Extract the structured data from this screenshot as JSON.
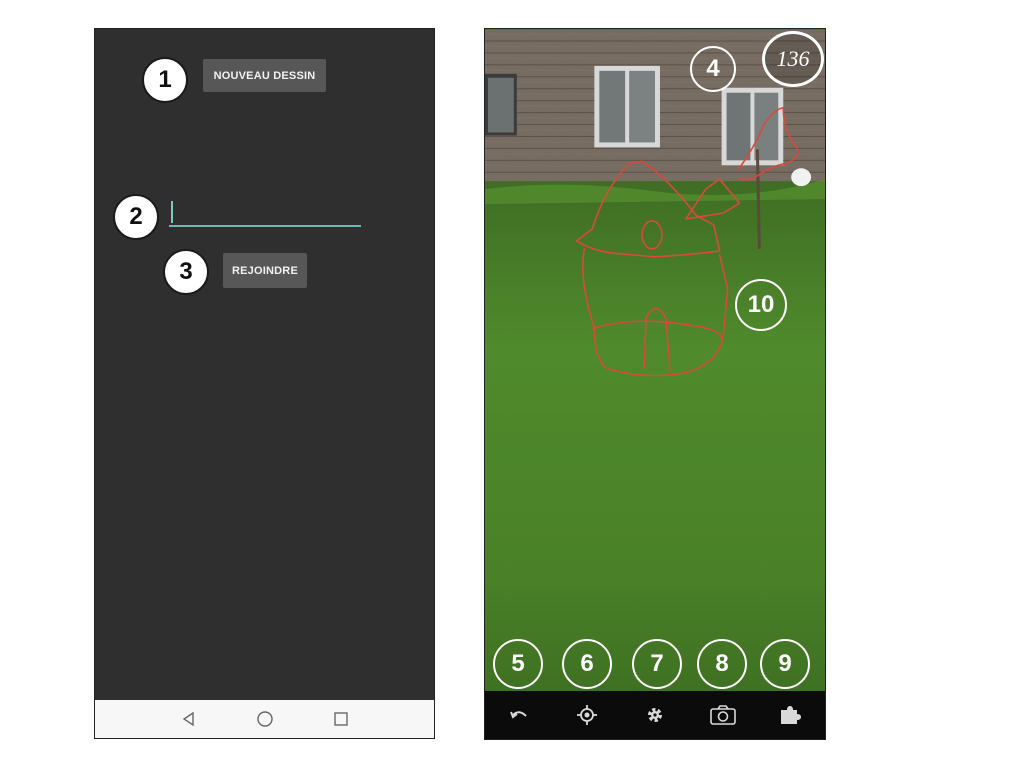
{
  "left_screen": {
    "new_drawing_label": "NOUVEAU DESSIN",
    "join_label": "REJOINDRE",
    "code_input_value": "",
    "annotations": [
      "1",
      "2",
      "3"
    ]
  },
  "right_screen": {
    "counter": "136",
    "annotations": [
      "4",
      "5",
      "6",
      "7",
      "8",
      "9",
      "10"
    ],
    "toolbar_icons": [
      "undo-icon",
      "center-target-icon",
      "settings-icon",
      "camera-icon",
      "extensions-icon"
    ]
  },
  "android_nav": [
    "back-icon",
    "home-icon",
    "recents-icon"
  ],
  "colors": {
    "left_bg": "#2f2f2f",
    "button_bg": "#575757",
    "input_accent": "#6fb8b0",
    "drawing_stroke": "#d84a3a",
    "toolbar_bg": "#0b0b0b"
  }
}
